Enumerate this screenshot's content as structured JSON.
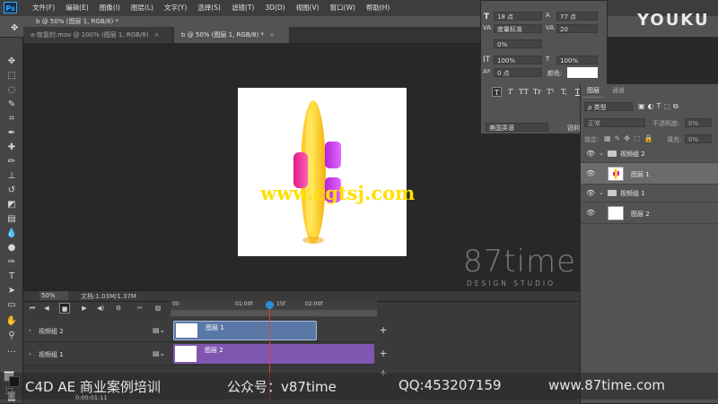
{
  "app": {
    "logo": "Ps",
    "doc_title": "b @ 50% (图层 1, RGB/8) *"
  },
  "menu": [
    "文件(F)",
    "编辑(E)",
    "图像(I)",
    "图层(L)",
    "文字(Y)",
    "选择(S)",
    "滤镜(T)",
    "3D(D)",
    "视图(V)",
    "窗口(W)",
    "帮助(H)"
  ],
  "tabs": [
    {
      "label": "a-恢复的.mov @ 100% (图层 1, RGB/8)",
      "close": "×"
    },
    {
      "label": "b @ 50% (图层 1, RGB/8) *",
      "close": "×"
    }
  ],
  "canvas": {
    "watermark_url": "www.cgtsj.com",
    "studio_logo": "87time",
    "studio_sub": "DESIGN STUDIO",
    "youku": "YOUKU"
  },
  "status": {
    "zoom": "50%",
    "doc_size": "文档:1.03M/1.37M"
  },
  "character_panel": {
    "font_size": "18 点",
    "leading": "77 点",
    "kerning": "度量标准",
    "tracking": "20",
    "scale_pct": "0%",
    "vscale": "100%",
    "hscale": "100%",
    "baseline": "0 点",
    "color_label": "颜色:",
    "language": "美国英语",
    "aa": "锐利",
    "type_buttons": [
      "T",
      "T",
      "TT",
      "Tr",
      "T¹",
      "T,",
      "T",
      "T"
    ]
  },
  "layers_panel": {
    "tabs": [
      "图层",
      "通道"
    ],
    "filter_label": "ρ 类型",
    "blend_mode": "正常",
    "opacity_label": "不透明度:",
    "opacity": "0%",
    "lock_label": "锁定:",
    "fill_label": "填充:",
    "fill": "0%",
    "layers": [
      {
        "name": "视频组 2",
        "type": "group"
      },
      {
        "name": "图层 1",
        "type": "layer",
        "selected": true
      },
      {
        "name": "视频组 1",
        "type": "group"
      },
      {
        "name": "图层 2",
        "type": "layer"
      }
    ]
  },
  "timeline": {
    "ticks": [
      "00",
      "01:00f",
      "15f",
      "02:00f"
    ],
    "tracks": [
      {
        "name": "视频组 2",
        "clip": "图层 1"
      },
      {
        "name": "视频组 1",
        "clip": "图层 2"
      }
    ],
    "timecode": "0:00:01:11"
  },
  "banner": {
    "course": "C4D AE 商业案例培训",
    "wechat": "公众号：v87time",
    "qq": "QQ:453207159",
    "site": "www.87time.com"
  },
  "colors": {
    "accent": "#31a8ff",
    "clip_blue": "#5a78a6",
    "clip_purple": "#8057b0",
    "watermark": "#ffe000"
  }
}
